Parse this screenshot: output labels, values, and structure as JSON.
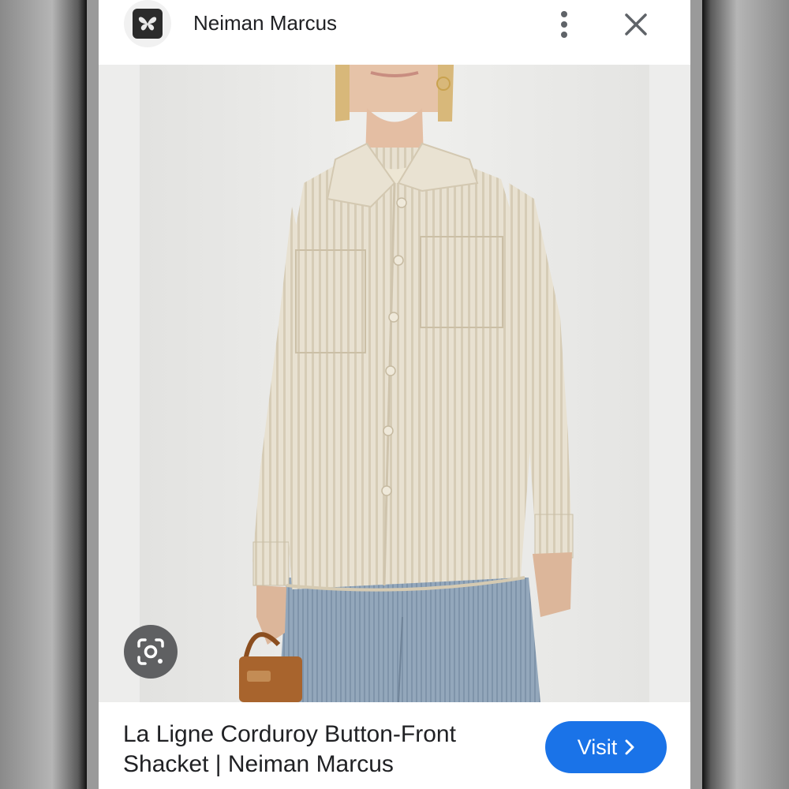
{
  "header": {
    "source_name": "Neiman Marcus",
    "logo_icon": "butterfly-icon",
    "more_icon": "more-vertical-icon",
    "close_icon": "close-icon"
  },
  "image": {
    "subject": "product-photo",
    "lens_icon": "lens-search-icon"
  },
  "caption": {
    "line1": "La Ligne Corduroy Button-Front",
    "line2": "Shacket | Neiman Marcus"
  },
  "visit_button": {
    "label": "Visit",
    "icon": "chevron-right-icon"
  },
  "colors": {
    "accent": "#1a73e8",
    "text": "#202124",
    "shirt": "#e6decd",
    "jeans": "#8fa3b8"
  }
}
